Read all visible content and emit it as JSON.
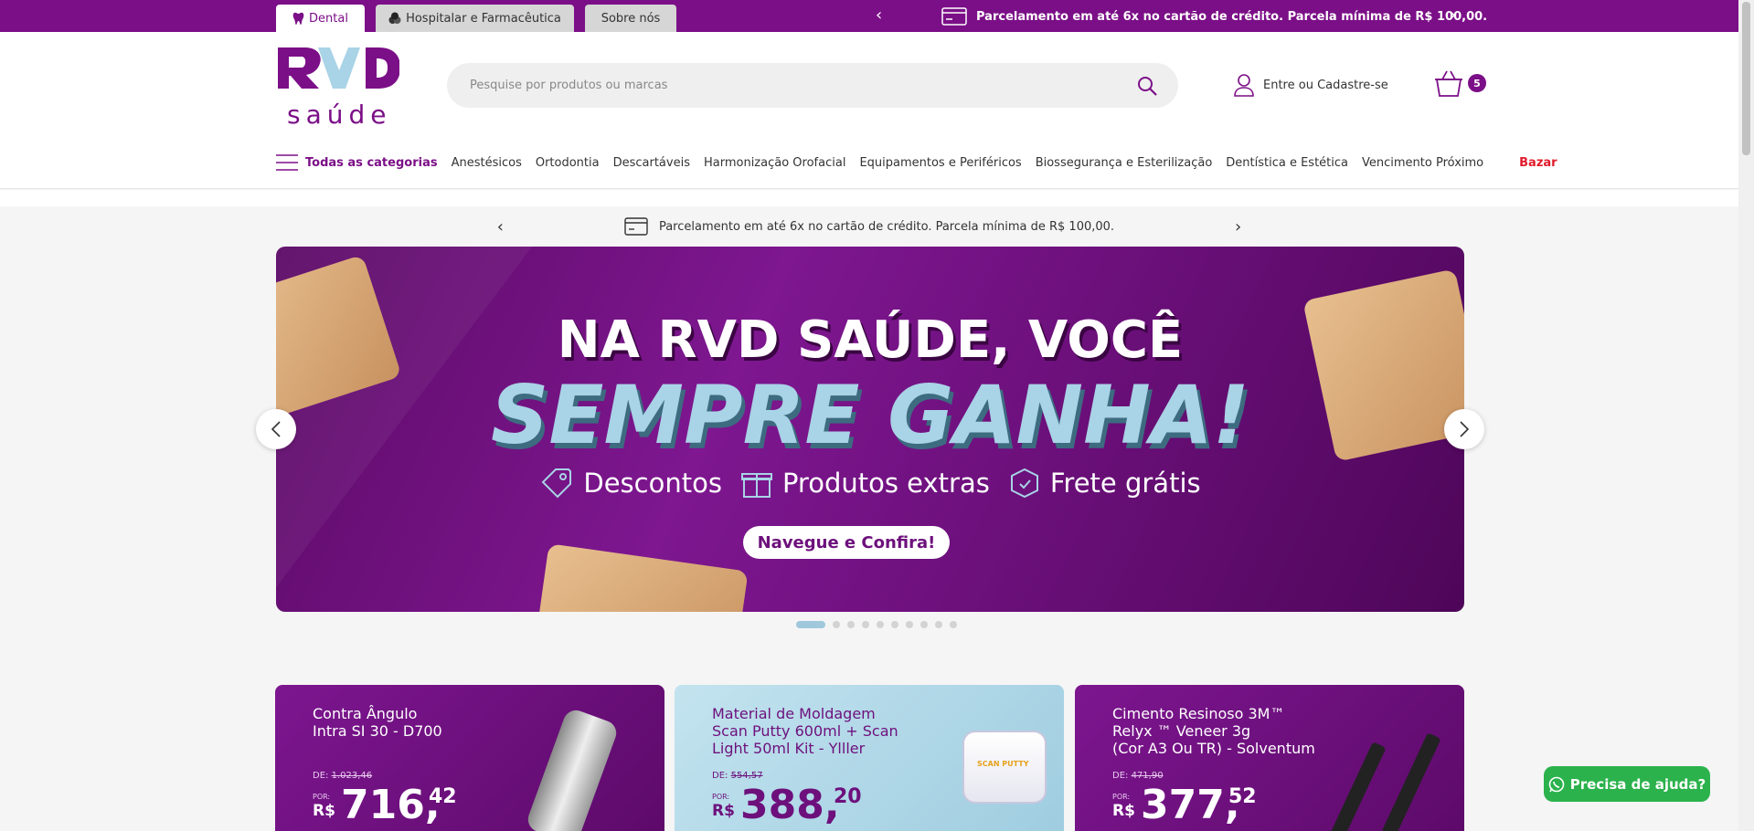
{
  "topbar": {
    "tabs": [
      {
        "label": "Dental",
        "icon": "tooth-icon"
      },
      {
        "label": "Hospitalar e Farmacêutica",
        "icon": "pills-icon"
      },
      {
        "label": "Sobre nós"
      }
    ],
    "promo": "Parcelamento em até 6x no cartão de crédito. Parcela mínima de R$ 100,00."
  },
  "header": {
    "logo_text": "saúde",
    "logo_mark": "RVD",
    "search_placeholder": "Pesquise por produtos ou marcas",
    "login_label": "Entre ou Cadastre-se",
    "cart_count": "5"
  },
  "nav": {
    "all_label": "Todas as categorias",
    "items": [
      "Anestésicos",
      "Ortodontia",
      "Descartáveis",
      "Harmonização Orofacial",
      "Equipamentos e Periféricos",
      "Biossegurança e Esterilização",
      "Dentística e Estética",
      "Vencimento Próximo"
    ],
    "bazar_label": "Bazar"
  },
  "infobar": {
    "text": "Parcelamento em até 6x no cartão de crédito. Parcela mínima de R$ 100,00."
  },
  "banner": {
    "line1": "NA RVD SAÚDE, VOCÊ",
    "line2": "SEMPRE GANHA!",
    "features": [
      "Descontos",
      "Produtos extras",
      "Frete grátis"
    ],
    "cta": "Navegue e Confira!",
    "slide_count": 10,
    "active_slide": 1
  },
  "cards": [
    {
      "name_lines": [
        "Contra Ângulo",
        "Intra SI 30 - D700"
      ],
      "de_label": "DE:",
      "old_price": "1.023,46",
      "por_label": "POR:",
      "currency": "R$",
      "price_int": "716,",
      "price_cents": "42"
    },
    {
      "name_lines": [
        "Material de Moldagem",
        "Scan Putty 600ml + Scan",
        "Light 50ml Kit - Ylller"
      ],
      "de_label": "DE:",
      "old_price": "554,57",
      "por_label": "POR:",
      "currency": "R$",
      "price_int": "388,",
      "price_cents": "20",
      "product_label": "SCAN PUTTY"
    },
    {
      "name_lines": [
        "Cimento Resinoso 3M™",
        "Relyx ™ Veneer 3g",
        "(Cor A3 Ou TR) - Solventum"
      ],
      "de_label": "DE:",
      "old_price": "471,90",
      "por_label": "POR:",
      "currency": "R$",
      "price_int": "377,",
      "price_cents": "52"
    }
  ],
  "help": {
    "label": "Precisa de ajuda?"
  },
  "colors": {
    "brand": "#7b0f87",
    "accent_light": "#a9d3e6",
    "whatsapp": "#2bb24c",
    "bazar": "#e01b2b"
  }
}
